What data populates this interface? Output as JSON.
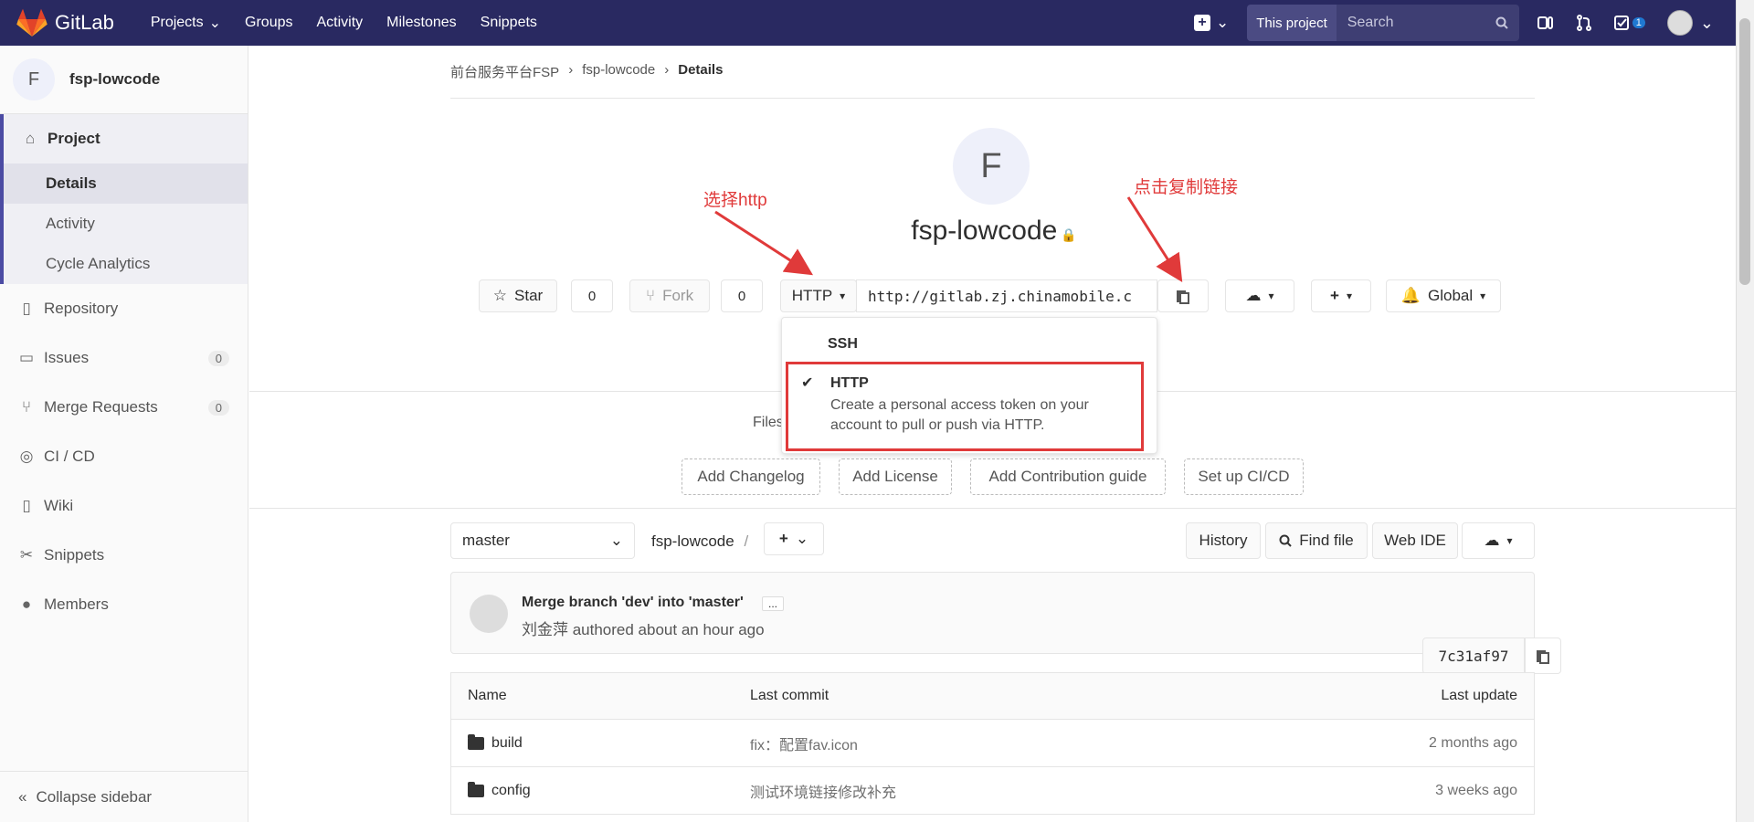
{
  "topnav": {
    "brand": "GitLab",
    "links": [
      "Projects",
      "Groups",
      "Activity",
      "Milestones",
      "Snippets"
    ],
    "this_project": "This project",
    "search_placeholder": "Search",
    "todo_count": "1"
  },
  "sidebar": {
    "project_initial": "F",
    "project_name": "fsp-lowcode",
    "section": "Project",
    "sub_items": [
      "Details",
      "Activity",
      "Cycle Analytics"
    ],
    "items": [
      {
        "label": "Repository",
        "icon": "book-icon"
      },
      {
        "label": "Issues",
        "icon": "issues-icon",
        "count": "0"
      },
      {
        "label": "Merge Requests",
        "icon": "merge-request-icon",
        "count": "0"
      },
      {
        "label": "CI / CD",
        "icon": "rocket-icon"
      },
      {
        "label": "Wiki",
        "icon": "book-icon"
      },
      {
        "label": "Snippets",
        "icon": "scissors-icon"
      },
      {
        "label": "Members",
        "icon": "users-icon"
      }
    ],
    "collapse": "Collapse sidebar"
  },
  "breadcrumb": [
    "前台服务平台FSP",
    "fsp-lowcode",
    "Details"
  ],
  "project": {
    "initial": "F",
    "title": "fsp-lowcode",
    "star_label": "Star",
    "star_count": "0",
    "fork_label": "Fork",
    "fork_count": "0",
    "protocol": "HTTP",
    "clone_url": "http://gitlab.zj.chinamobile.c",
    "notification": "Global"
  },
  "clone_dropdown": {
    "ssh": "SSH",
    "http_title": "HTTP",
    "http_desc": "Create a personal access token on your account to pull or push via HTTP."
  },
  "annotations": {
    "select_http": "选择http",
    "click_copy": "点击复制链接"
  },
  "files_label": "Files",
  "add_buttons": [
    "Add Changelog",
    "Add License",
    "Add Contribution guide",
    "Set up CI/CD"
  ],
  "repo_toolbar": {
    "branch": "master",
    "path": "fsp-lowcode",
    "separator": "/",
    "history": "History",
    "find_file": "Find file",
    "web_ide": "Web IDE"
  },
  "commit": {
    "title": "Merge branch 'dev' into 'master'",
    "more": "...",
    "author": "刘金萍 authored about an hour ago",
    "sha": "7c31af97"
  },
  "table": {
    "headers": [
      "Name",
      "Last commit",
      "Last update"
    ],
    "rows": [
      {
        "name": "build",
        "commit": "fix：配置fav.icon",
        "updated": "2 months ago"
      },
      {
        "name": "config",
        "commit": "测试环境链接修改补充",
        "updated": "3 weeks ago"
      }
    ]
  }
}
